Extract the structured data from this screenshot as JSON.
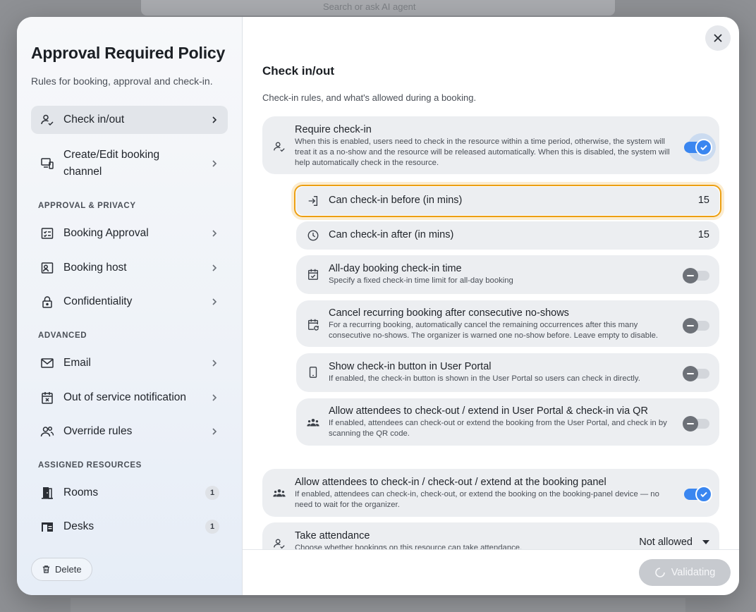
{
  "background": {
    "search_placeholder": "Search or ask AI agent"
  },
  "sidebar": {
    "title": "Approval Required Policy",
    "subtitle": "Rules for booking, approval and check-in.",
    "items_top": [
      {
        "label": "Check in/out",
        "icon": "user-check-icon",
        "active": true
      },
      {
        "label": "Create/Edit booking channel",
        "icon": "devices-icon"
      }
    ],
    "section_approval": "APPROVAL & PRIVACY",
    "items_approval": [
      {
        "label": "Booking Approval",
        "icon": "checklist-icon"
      },
      {
        "label": "Booking host",
        "icon": "host-icon"
      },
      {
        "label": "Confidentiality",
        "icon": "lock-icon"
      }
    ],
    "section_advanced": "ADVANCED",
    "items_advanced": [
      {
        "label": "Email",
        "icon": "mail-icon"
      },
      {
        "label": "Out of service notification",
        "icon": "calendar-x-icon"
      },
      {
        "label": "Override rules",
        "icon": "users-icon"
      }
    ],
    "section_resources": "ASSIGNED RESOURCES",
    "items_resources": [
      {
        "label": "Rooms",
        "icon": "door-icon",
        "count": "1"
      },
      {
        "label": "Desks",
        "icon": "desk-icon",
        "count": "1"
      }
    ],
    "delete_label": "Delete"
  },
  "main": {
    "heading": "Check in/out",
    "description": "Check-in rules, and what's allowed during a booking.",
    "require_checkin": {
      "title": "Require check-in",
      "desc": "When this is enabled, users need to check in the resource within a time period, otherwise, the system will treat it as a no-show and the resource will be released automatically. When this is disabled, the system will help automatically check in the resource.",
      "enabled": true
    },
    "checkin_before": {
      "title": "Can check-in before (in mins)",
      "value": "15"
    },
    "checkin_after": {
      "title": "Can check-in after (in mins)",
      "value": "15"
    },
    "allday": {
      "title": "All-day booking check-in time",
      "desc": "Specify a fixed check-in time limit for all-day booking",
      "enabled": false
    },
    "cancel_recurring": {
      "title": "Cancel recurring booking after consecutive no-shows",
      "desc": "For a recurring booking, automatically cancel the remaining occurrences after this many consecutive no-shows. The organizer is warned one no-show before. Leave empty to disable.",
      "enabled": false
    },
    "show_button": {
      "title": "Show check-in button in User Portal",
      "desc": "If enabled, the check-in button is shown in the User Portal so users can check in directly.",
      "enabled": false
    },
    "allow_portal": {
      "title": "Allow attendees to check-out / extend in User Portal & check-in via QR",
      "desc": "If enabled, attendees can check-out or extend the booking from the User Portal, and check in by scanning the QR code.",
      "enabled": false
    },
    "allow_panel": {
      "title": "Allow attendees to check-in / check-out / extend at the booking panel",
      "desc": "If enabled, attendees can check-in, check-out, or extend the booking on the booking-panel device — no need to wait for the organizer.",
      "enabled": true
    },
    "attendance": {
      "title": "Take attendance",
      "desc": "Choose whether bookings on this resource can take attendance.",
      "value": "Not allowed"
    }
  },
  "footer": {
    "validate_label": "Validating"
  },
  "colors": {
    "accent": "#3a86f0",
    "focus": "#ec9f12"
  }
}
